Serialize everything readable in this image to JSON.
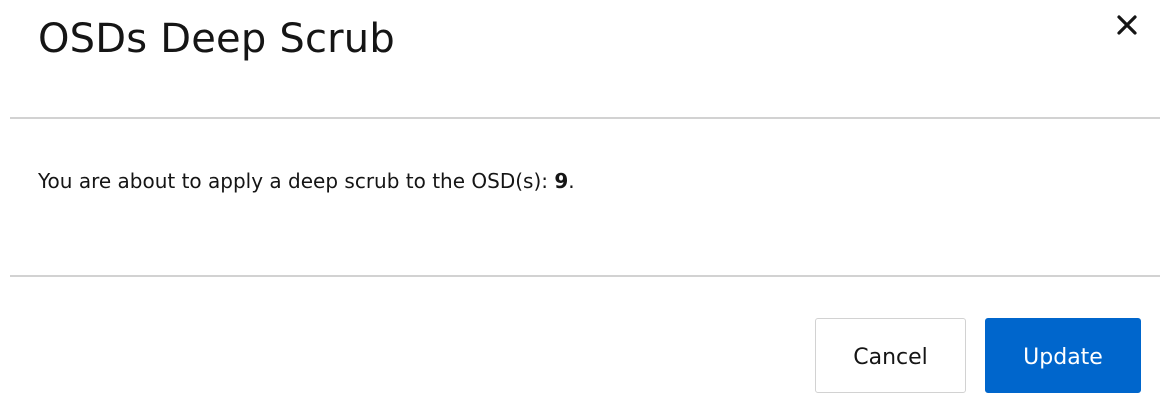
{
  "modal": {
    "title": "OSDs Deep Scrub",
    "close_icon": "close-icon",
    "message_prefix": "You are about to apply a deep scrub to the OSD(s): ",
    "osd_ids": "9",
    "message_suffix": "."
  },
  "footer": {
    "cancel_label": "Cancel",
    "update_label": "Update"
  },
  "colors": {
    "primary": "#0066cc",
    "divider": "#d2d2d2",
    "text": "#151515"
  }
}
